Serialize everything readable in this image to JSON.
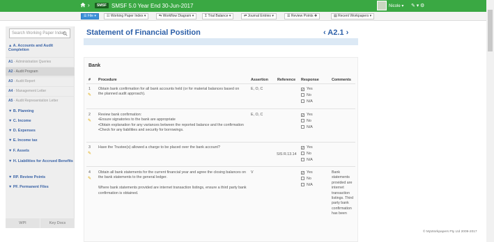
{
  "header": {
    "crumb_sep": "›",
    "logo": "SMSF",
    "title": "SMSF 5.0  Year End 30-Jun-2017",
    "user": "Nicole ▾",
    "pen": "✎ ▾",
    "gear": "⚙"
  },
  "toolbar": {
    "file": "☰ File  ▾",
    "working_paper_index": "☷ Working Paper Index  ▾",
    "workflow_diagram": "⇆ Workflow Diagram  ▾",
    "trial_balance": "Σ Trial Balance  ▾",
    "journal_entries": "⇄ Journal Entries  ▾",
    "review_points": "☰ Review Points  ✚",
    "recent_workpapers": "▤ Recent Workpapers  ▾"
  },
  "sidebar": {
    "search_placeholder": "Search Working Paper Index",
    "sections": [
      "▲ A. Accounts and Audit Completion",
      "▼ B. Planning",
      "▼ C. Income",
      "▼ D. Expenses",
      "▼ E. Income tax",
      "▼ F. Assets",
      "▼ H. Liabilities for Accrued Benefits",
      "▼ RP. Review Points",
      "▼ PF. Permanent Files"
    ],
    "items": [
      {
        "code": "A1",
        "label": " - Administration Queries"
      },
      {
        "code": "A2",
        "label": " - Audit Program"
      },
      {
        "code": "A3",
        "label": " - Audit Report"
      },
      {
        "code": "A4",
        "label": " - Management Letter"
      },
      {
        "code": "A5",
        "label": " - Audit Representation Letter"
      }
    ],
    "footer": {
      "left": "WPI",
      "right": "Key Docs"
    }
  },
  "main": {
    "title": "Statement of Financial Position",
    "ref": "‹  A2.1  ›",
    "section": "Bank",
    "columns": [
      "#",
      "Procedure",
      "Assertion",
      "Reference",
      "Response",
      "Comments"
    ],
    "options": [
      "Yes",
      "No",
      "N/A"
    ],
    "rows": [
      {
        "num": "1",
        "procedure": "Obtain bank confirmation for all bank accounts held (or for material balances based on the planned audit approach).",
        "assertion": "E, O, C",
        "reference": "",
        "response": "Yes",
        "comments": ""
      },
      {
        "num": "2",
        "procedure": "Review bank confirmation:\n•Ensure signatories to the bank are appropriate\n•Obtain explanation for any variances between the reported balance and the confirmation\n•Check for any liabilities and security for borrowings.",
        "assertion": "E, O, C",
        "reference": "",
        "response": "Yes",
        "comments": ""
      },
      {
        "num": "3",
        "procedure": "Have the Trustee(s) allowed a charge to be placed over the bank account?",
        "assertion": "",
        "reference": "SIS R.13.14",
        "response": "Yes",
        "comments": ""
      },
      {
        "num": "4",
        "procedure": "Obtain all bank statements for the current financial year and agree the closing balances on the bank statements to the general ledger.\n\nWhere bank statements provided are internet transaction listings, ensure a third party bank confirmation is obtained.",
        "assertion": "V",
        "reference": "",
        "response": "Yes",
        "comments": "Bank statements provided are internet transaction listings. Third party bank confirmation has been"
      }
    ]
  },
  "footer": {
    "copyright": "© MyWorkpapers Pty Ltd 2009-2017"
  }
}
